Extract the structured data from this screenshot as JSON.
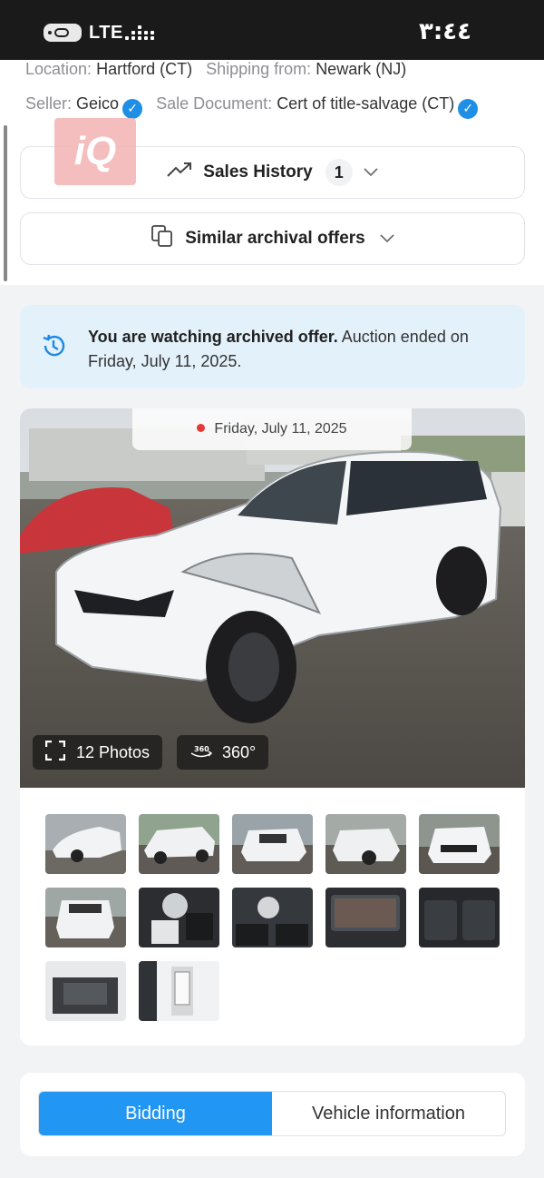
{
  "status_bar": {
    "network": "LTE",
    "time": "٣:٤٤"
  },
  "details": {
    "location_label": "Location:",
    "location_value": "Hartford (CT)",
    "shipping_label": "Shipping from:",
    "shipping_value": "Newark (NJ)",
    "seller_label": "Seller:",
    "seller_value": "Geico",
    "sale_doc_label": "Sale Document:",
    "sale_doc_value": "Cert of title-salvage (CT)"
  },
  "watermark": "iQ",
  "sales_history": {
    "label": "Sales History",
    "count": "1"
  },
  "similar_offers": {
    "label": "Similar archival offers"
  },
  "notice": {
    "bold": "You are watching archived offer.",
    "rest": " Auction ended on Friday, July 11, 2025."
  },
  "gallery": {
    "date": "Friday, July 11, 2025",
    "photos_label": "12 Photos",
    "view360_label": "360°",
    "thumbnails": [
      "front-left exterior",
      "rear-left exterior",
      "rear exterior",
      "front exterior",
      "front exterior close",
      "rear exterior",
      "driver interior",
      "dashboard interior",
      "infotainment screen",
      "rear seats interior",
      "engine bay",
      "door jamb label"
    ]
  },
  "tabs": {
    "bidding": "Bidding",
    "vehicle_info": "Vehicle information"
  },
  "colors": {
    "accent": "#2196f3",
    "verified": "#1f8fe5",
    "notice_bg": "#e3f1fb",
    "live_dot": "#e53935"
  }
}
